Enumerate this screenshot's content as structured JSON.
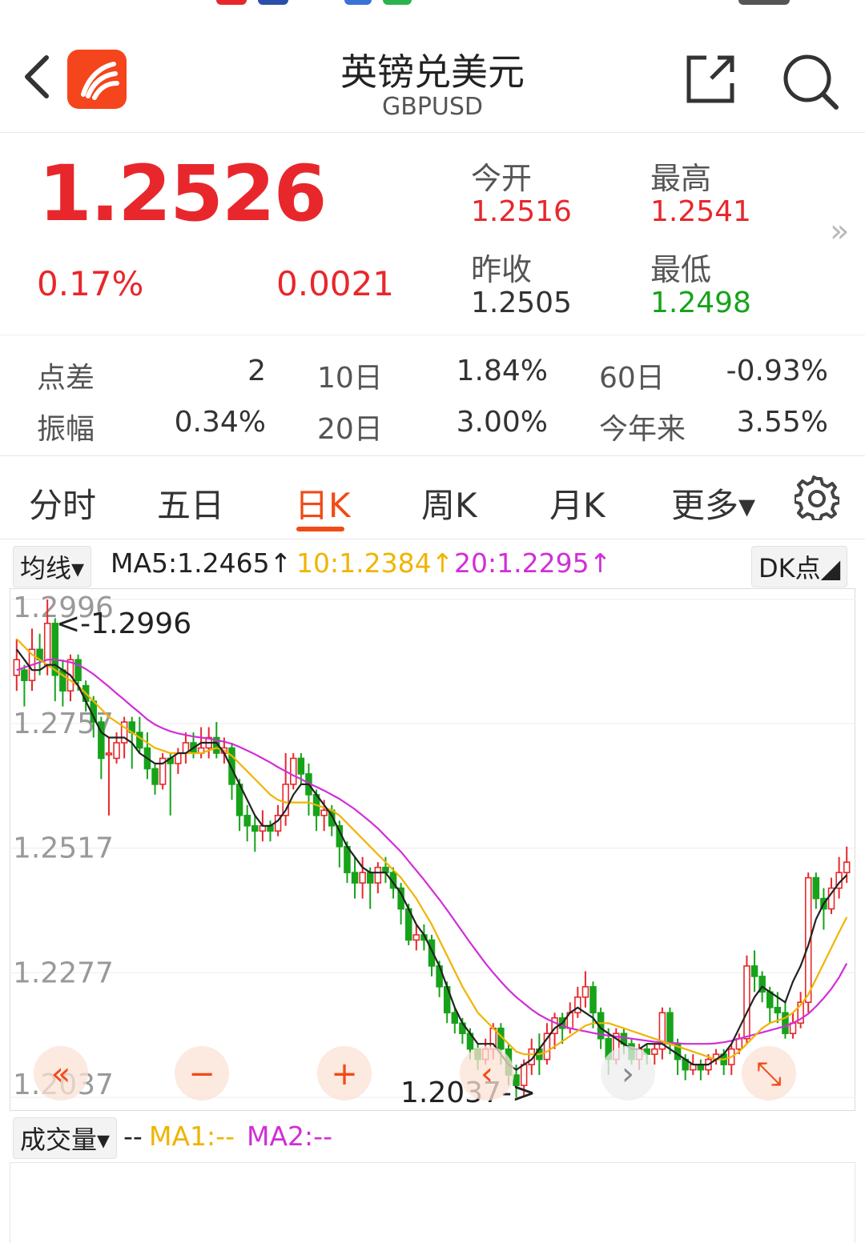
{
  "header": {
    "title": "英镑兑美元",
    "subtitle": "GBPUSD"
  },
  "quote": {
    "price": "1.2526",
    "change_pct": "0.17%",
    "change_abs": "0.0021",
    "open_label": "今开",
    "open_value": "1.2516",
    "high_label": "最高",
    "high_value": "1.2541",
    "prev_close_label": "昨收",
    "prev_close_value": "1.2505",
    "low_label": "最低",
    "low_value": "1.2498",
    "more_icon": "»"
  },
  "stats": {
    "spread_label": "点差",
    "spread_value": "2",
    "d10_label": "10日",
    "d10_value": "1.84%",
    "d60_label": "60日",
    "d60_value": "-0.93%",
    "amplitude_label": "振幅",
    "amplitude_value": "0.34%",
    "d20_label": "20日",
    "d20_value": "3.00%",
    "ytd_label": "今年来",
    "ytd_value": "3.55%"
  },
  "tabs": [
    {
      "label": "分时"
    },
    {
      "label": "五日"
    },
    {
      "label": "日K"
    },
    {
      "label": "周K"
    },
    {
      "label": "月K"
    },
    {
      "label": "更多▾"
    }
  ],
  "active_tab": "日K",
  "ma_bar": {
    "selector": "均线▾",
    "ma5": "MA5:1.2465↑",
    "ma10": "10:1.2384↑",
    "ma20": "20:1.2295↑",
    "dk_button": "DK点◢"
  },
  "volume_bar": {
    "selector": "成交量▾",
    "dash": "--",
    "ma1": "MA1:--",
    "ma2": "MA2:--"
  },
  "colors": {
    "up": "#e8272c",
    "down": "#16a31a",
    "accent": "#f04b16",
    "ma5": "#222222",
    "ma10": "#f0b400",
    "ma20": "#d12ed8"
  },
  "chart_data": {
    "type": "candlestick",
    "y_ticks": [
      "1.2996",
      "1.2757",
      "1.2517",
      "1.2277",
      "1.2037"
    ],
    "ylim": [
      1.2037,
      1.2996
    ],
    "high_marker": "<-1.2996",
    "low_marker": "1.2037->",
    "candles": [
      [
        1.285,
        1.288,
        1.292,
        1.282
      ],
      [
        1.286,
        1.284,
        1.287,
        1.279
      ],
      [
        1.284,
        1.29,
        1.294,
        1.282
      ],
      [
        1.29,
        1.288,
        1.293,
        1.285
      ],
      [
        1.287,
        1.295,
        1.2996,
        1.285
      ],
      [
        1.295,
        1.285,
        1.296,
        1.28
      ],
      [
        1.286,
        1.282,
        1.288,
        1.279
      ],
      [
        1.282,
        1.288,
        1.289,
        1.28
      ],
      [
        1.288,
        1.284,
        1.289,
        1.282
      ],
      [
        1.283,
        1.28,
        1.284,
        1.278
      ],
      [
        1.28,
        1.276,
        1.281,
        1.273
      ],
      [
        1.276,
        1.269,
        1.277,
        1.265
      ],
      [
        1.27,
        1.27,
        1.273,
        1.258
      ],
      [
        1.269,
        1.272,
        1.274,
        1.268
      ],
      [
        1.272,
        1.276,
        1.277,
        1.269
      ],
      [
        1.276,
        1.274,
        1.277,
        1.267
      ],
      [
        1.274,
        1.271,
        1.277,
        1.27
      ],
      [
        1.271,
        1.267,
        1.274,
        1.265
      ],
      [
        1.267,
        1.264,
        1.268,
        1.262
      ],
      [
        1.264,
        1.269,
        1.27,
        1.263
      ],
      [
        1.269,
        1.268,
        1.27,
        1.258
      ],
      [
        1.268,
        1.27,
        1.271,
        1.266
      ],
      [
        1.27,
        1.272,
        1.274,
        1.268
      ],
      [
        1.272,
        1.27,
        1.274,
        1.269
      ],
      [
        1.27,
        1.271,
        1.275,
        1.269
      ],
      [
        1.271,
        1.273,
        1.275,
        1.269
      ],
      [
        1.273,
        1.27,
        1.276,
        1.269
      ],
      [
        1.27,
        1.271,
        1.273,
        1.268
      ],
      [
        1.271,
        1.264,
        1.272,
        1.261
      ],
      [
        1.264,
        1.258,
        1.265,
        1.255
      ],
      [
        1.258,
        1.256,
        1.26,
        1.253
      ],
      [
        1.256,
        1.255,
        1.258,
        1.251
      ],
      [
        1.255,
        1.256,
        1.259,
        1.253
      ],
      [
        1.256,
        1.255,
        1.257,
        1.253
      ],
      [
        1.255,
        1.258,
        1.26,
        1.254
      ],
      [
        1.258,
        1.264,
        1.27,
        1.256
      ],
      [
        1.264,
        1.269,
        1.27,
        1.263
      ],
      [
        1.269,
        1.266,
        1.27,
        1.264
      ],
      [
        1.266,
        1.262,
        1.268,
        1.258
      ],
      [
        1.262,
        1.258,
        1.263,
        1.255
      ],
      [
        1.258,
        1.259,
        1.261,
        1.255
      ],
      [
        1.259,
        1.256,
        1.26,
        1.254
      ],
      [
        1.256,
        1.252,
        1.257,
        1.248
      ],
      [
        1.252,
        1.247,
        1.253,
        1.245
      ],
      [
        1.247,
        1.245,
        1.25,
        1.242
      ],
      [
        1.245,
        1.247,
        1.25,
        1.242
      ],
      [
        1.247,
        1.245,
        1.248,
        1.24
      ],
      [
        1.245,
        1.248,
        1.249,
        1.243
      ],
      [
        1.248,
        1.247,
        1.25,
        1.245
      ],
      [
        1.247,
        1.244,
        1.248,
        1.242
      ],
      [
        1.244,
        1.24,
        1.245,
        1.237
      ],
      [
        1.24,
        1.234,
        1.241,
        1.233
      ],
      [
        1.234,
        1.235,
        1.237,
        1.232
      ],
      [
        1.235,
        1.234,
        1.237,
        1.232
      ],
      [
        1.234,
        1.229,
        1.235,
        1.227
      ],
      [
        1.229,
        1.225,
        1.23,
        1.223
      ],
      [
        1.225,
        1.22,
        1.226,
        1.218
      ],
      [
        1.22,
        1.218,
        1.221,
        1.216
      ],
      [
        1.218,
        1.216,
        1.219,
        1.214
      ],
      [
        1.216,
        1.213,
        1.217,
        1.211
      ],
      [
        1.213,
        1.211,
        1.214,
        1.209
      ],
      [
        1.211,
        1.213,
        1.215,
        1.21
      ],
      [
        1.213,
        1.217,
        1.218,
        1.211
      ],
      [
        1.217,
        1.213,
        1.218,
        1.21
      ],
      [
        1.213,
        1.208,
        1.214,
        1.206
      ],
      [
        1.208,
        1.206,
        1.21,
        1.2037
      ],
      [
        1.206,
        1.21,
        1.211,
        1.2037
      ],
      [
        1.21,
        1.213,
        1.215,
        1.208
      ],
      [
        1.213,
        1.211,
        1.216,
        1.208
      ],
      [
        1.211,
        1.216,
        1.218,
        1.21
      ],
      [
        1.216,
        1.219,
        1.22,
        1.213
      ],
      [
        1.219,
        1.217,
        1.22,
        1.214
      ],
      [
        1.217,
        1.22,
        1.222,
        1.216
      ],
      [
        1.22,
        1.223,
        1.225,
        1.219
      ],
      [
        1.223,
        1.225,
        1.228,
        1.221
      ],
      [
        1.225,
        1.22,
        1.226,
        1.217
      ],
      [
        1.22,
        1.215,
        1.221,
        1.213
      ],
      [
        1.215,
        1.211,
        1.217,
        1.208
      ],
      [
        1.211,
        1.216,
        1.217,
        1.21
      ],
      [
        1.216,
        1.214,
        1.217,
        1.212
      ],
      [
        1.214,
        1.211,
        1.215,
        1.21
      ],
      [
        1.211,
        1.213,
        1.214,
        1.209
      ],
      [
        1.213,
        1.212,
        1.214,
        1.21
      ],
      [
        1.212,
        1.213,
        1.214,
        1.21
      ],
      [
        1.213,
        1.22,
        1.221,
        1.211
      ],
      [
        1.22,
        1.214,
        1.221,
        1.212
      ],
      [
        1.214,
        1.211,
        1.215,
        1.208
      ],
      [
        1.211,
        1.209,
        1.212,
        1.207
      ],
      [
        1.209,
        1.21,
        1.212,
        1.208
      ],
      [
        1.21,
        1.209,
        1.211,
        1.207
      ],
      [
        1.209,
        1.211,
        1.212,
        1.208
      ],
      [
        1.211,
        1.212,
        1.213,
        1.21
      ],
      [
        1.212,
        1.21,
        1.213,
        1.208
      ],
      [
        1.21,
        1.213,
        1.214,
        1.208
      ],
      [
        1.213,
        1.215,
        1.216,
        1.212
      ],
      [
        1.215,
        1.229,
        1.231,
        1.214
      ],
      [
        1.229,
        1.227,
        1.232,
        1.224
      ],
      [
        1.227,
        1.224,
        1.228,
        1.222
      ],
      [
        1.224,
        1.221,
        1.225,
        1.218
      ],
      [
        1.221,
        1.22,
        1.224,
        1.218
      ],
      [
        1.22,
        1.216,
        1.222,
        1.215
      ],
      [
        1.216,
        1.218,
        1.22,
        1.215
      ],
      [
        1.218,
        1.222,
        1.224,
        1.217
      ],
      [
        1.222,
        1.246,
        1.247,
        1.22
      ],
      [
        1.246,
        1.242,
        1.247,
        1.24
      ],
      [
        1.242,
        1.24,
        1.244,
        1.236
      ],
      [
        1.24,
        1.244,
        1.246,
        1.239
      ],
      [
        1.244,
        1.247,
        1.25,
        1.242
      ],
      [
        1.247,
        1.249,
        1.252,
        1.245
      ]
    ],
    "ma5": [
      1.29,
      1.288,
      1.286,
      1.286,
      1.287,
      1.287,
      1.286,
      1.285,
      1.283,
      1.28,
      1.277,
      1.274,
      1.273,
      1.273,
      1.273,
      1.272,
      1.27,
      1.269,
      1.268,
      1.268,
      1.269,
      1.27,
      1.27,
      1.271,
      1.272,
      1.272,
      1.272,
      1.27,
      1.267,
      1.264,
      1.261,
      1.258,
      1.256,
      1.256,
      1.257,
      1.259,
      1.262,
      1.264,
      1.264,
      1.262,
      1.26,
      1.258,
      1.255,
      1.252,
      1.25,
      1.248,
      1.247,
      1.247,
      1.247,
      1.245,
      1.243,
      1.24,
      1.237,
      1.235,
      1.232,
      1.229,
      1.225,
      1.221,
      1.218,
      1.216,
      1.214,
      1.214,
      1.214,
      1.212,
      1.21,
      1.209,
      1.21,
      1.211,
      1.213,
      1.215,
      1.217,
      1.218,
      1.22,
      1.221,
      1.22,
      1.219,
      1.217,
      1.216,
      1.215,
      1.214,
      1.213,
      1.213,
      1.214,
      1.214,
      1.214,
      1.213,
      1.212,
      1.211,
      1.21,
      1.21,
      1.21,
      1.211,
      1.212,
      1.214,
      1.217,
      1.22,
      1.223,
      1.225,
      1.224,
      1.223,
      1.222,
      1.226,
      1.229,
      1.233,
      1.238,
      1.241,
      1.243,
      1.245,
      1.2465
    ],
    "ma10": [
      1.292,
      1.2905,
      1.289,
      1.288,
      1.287,
      1.286,
      1.285,
      1.284,
      1.283,
      1.2815,
      1.28,
      1.2785,
      1.277,
      1.276,
      1.275,
      1.274,
      1.273,
      1.272,
      1.271,
      1.2705,
      1.27,
      1.27,
      1.27,
      1.27,
      1.27,
      1.2705,
      1.271,
      1.2705,
      1.2695,
      1.268,
      1.2665,
      1.265,
      1.2635,
      1.262,
      1.261,
      1.2605,
      1.2605,
      1.2605,
      1.2605,
      1.26,
      1.2595,
      1.259,
      1.258,
      1.2565,
      1.255,
      1.2535,
      1.252,
      1.2505,
      1.249,
      1.2475,
      1.246,
      1.244,
      1.242,
      1.2395,
      1.237,
      1.234,
      1.231,
      1.228,
      1.225,
      1.2225,
      1.22,
      1.2185,
      1.217,
      1.2155,
      1.214,
      1.2125,
      1.212,
      1.212,
      1.212,
      1.2125,
      1.2135,
      1.2145,
      1.2155,
      1.2165,
      1.2175,
      1.218,
      1.218,
      1.218,
      1.2175,
      1.217,
      1.2165,
      1.216,
      1.2155,
      1.215,
      1.2145,
      1.214,
      1.2135,
      1.213,
      1.2125,
      1.212,
      1.2115,
      1.211,
      1.211,
      1.2115,
      1.2125,
      1.214,
      1.2155,
      1.217,
      1.218,
      1.2185,
      1.219,
      1.22,
      1.2215,
      1.2235,
      1.2265,
      1.2295,
      1.2325,
      1.2355,
      1.2384
    ],
    "ma20": [
      1.286,
      1.2865,
      1.287,
      1.2875,
      1.288,
      1.288,
      1.2878,
      1.2875,
      1.287,
      1.2862,
      1.2852,
      1.284,
      1.2828,
      1.2815,
      1.2803,
      1.279,
      1.2778,
      1.2765,
      1.2755,
      1.2748,
      1.2742,
      1.2738,
      1.2735,
      1.2732,
      1.273,
      1.2728,
      1.2725,
      1.2722,
      1.2718,
      1.2712,
      1.2705,
      1.2698,
      1.269,
      1.2682,
      1.2673,
      1.2665,
      1.2657,
      1.265,
      1.2642,
      1.2635,
      1.2628,
      1.262,
      1.2612,
      1.2602,
      1.2592,
      1.258,
      1.2568,
      1.2555,
      1.254,
      1.2525,
      1.251,
      1.2492,
      1.2474,
      1.2456,
      1.2437,
      1.2418,
      1.2398,
      1.2377,
      1.2356,
      1.2335,
      1.2315,
      1.2295,
      1.2277,
      1.226,
      1.2244,
      1.223,
      1.2218,
      1.2206,
      1.2196,
      1.2188,
      1.2181,
      1.2175,
      1.217,
      1.2167,
      1.2164,
      1.2161,
      1.2158,
      1.2156,
      1.2154,
      1.2152,
      1.215,
      1.2148,
      1.2146,
      1.2144,
      1.2143,
      1.2142,
      1.2141,
      1.214,
      1.214,
      1.214,
      1.214,
      1.2141,
      1.2143,
      1.2146,
      1.215,
      1.2154,
      1.2158,
      1.2162,
      1.2166,
      1.217,
      1.2174,
      1.218,
      1.2188,
      1.2198,
      1.2212,
      1.2228,
      1.2246,
      1.2268,
      1.2295
    ]
  },
  "overlay_controls": [
    "«",
    "−",
    "+",
    "‹",
    "›",
    "⤡"
  ]
}
